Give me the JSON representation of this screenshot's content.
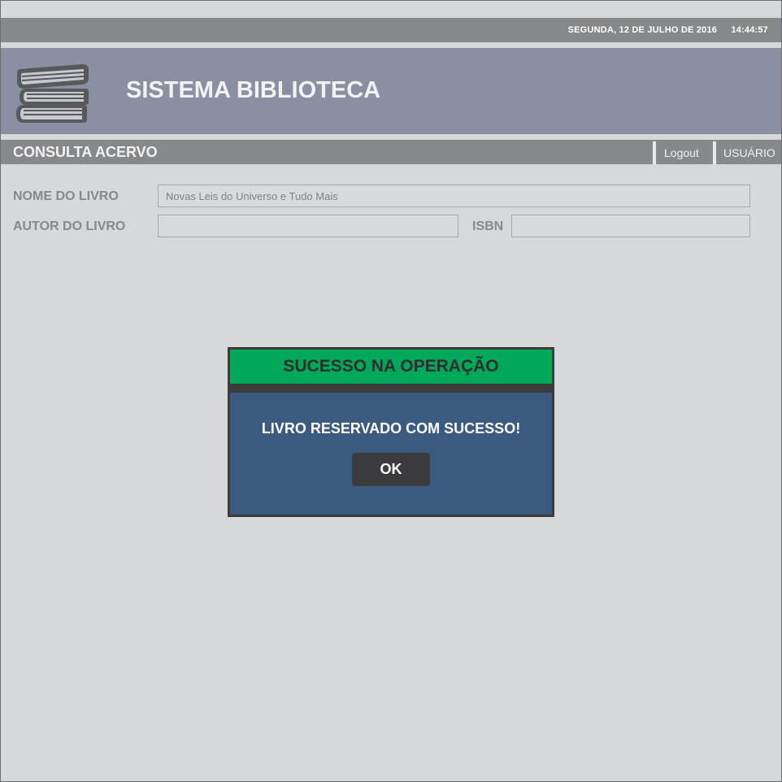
{
  "topbar": {
    "date": "SEGUNDA, 12 DE JULHO DE 2016",
    "time": "14:44:57"
  },
  "header": {
    "logo_icon": "books-stack-icon",
    "app_title": "SISTEMA BIBLIOTECA"
  },
  "navbar": {
    "section_title": "CONSULTA ACERVO",
    "logout_label": "Logout",
    "user_label": "USUÁRIO"
  },
  "form": {
    "book_name_label": "NOME DO LIVRO",
    "book_name_value": "Novas Leis do Universo e Tudo Mais",
    "author_label": "AUTOR DO LIVRO",
    "author_value": "",
    "isbn_label": "ISBN",
    "isbn_value": ""
  },
  "dialog": {
    "title": "SUCESSO NA OPERAÇÃO",
    "message": "LIVRO RESERVADO COM SUCESSO!",
    "ok_label": "OK"
  },
  "colors": {
    "background": "#d7d8da",
    "bar": "#87888a",
    "header": "#8a8fa1",
    "success": "#00a859",
    "dialog": "#3a5a7f",
    "button": "#3b3b3d"
  }
}
